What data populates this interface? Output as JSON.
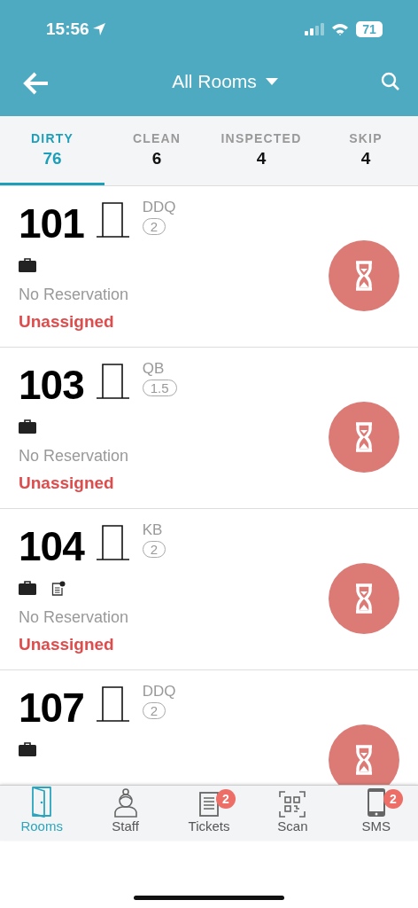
{
  "status_bar": {
    "time": "15:56",
    "battery": "71"
  },
  "header": {
    "title": "All Rooms"
  },
  "tabs": [
    {
      "label": "DIRTY",
      "count": "76",
      "selected": true
    },
    {
      "label": "CLEAN",
      "count": "6",
      "selected": false
    },
    {
      "label": "INSPECTED",
      "count": "4",
      "selected": false
    },
    {
      "label": "SKIP",
      "count": "4",
      "selected": false
    }
  ],
  "rooms": [
    {
      "number": "101",
      "type": "DDQ",
      "occupancy": "2",
      "icons": [
        {
          "kind": "luggage"
        }
      ],
      "reservation": "No Reservation",
      "assignee": "Unassigned"
    },
    {
      "number": "103",
      "type": "QB",
      "occupancy": "1.5",
      "icons": [
        {
          "kind": "luggage"
        }
      ],
      "reservation": "No Reservation",
      "assignee": "Unassigned"
    },
    {
      "number": "104",
      "type": "KB",
      "occupancy": "2",
      "icons": [
        {
          "kind": "luggage"
        },
        {
          "kind": "note"
        }
      ],
      "reservation": "No Reservation",
      "assignee": "Unassigned"
    },
    {
      "number": "107",
      "type": "DDQ",
      "occupancy": "2",
      "icons": [
        {
          "kind": "luggage"
        }
      ]
    }
  ],
  "nav": [
    {
      "kind": "rooms",
      "label": "Rooms",
      "selected": true
    },
    {
      "kind": "staff",
      "label": "Staff",
      "selected": false
    },
    {
      "kind": "tickets",
      "label": "Tickets",
      "badge": "2",
      "selected": false
    },
    {
      "kind": "scan",
      "label": "Scan",
      "selected": false
    },
    {
      "kind": "sms",
      "label": "SMS",
      "badge": "2",
      "selected": false
    }
  ]
}
